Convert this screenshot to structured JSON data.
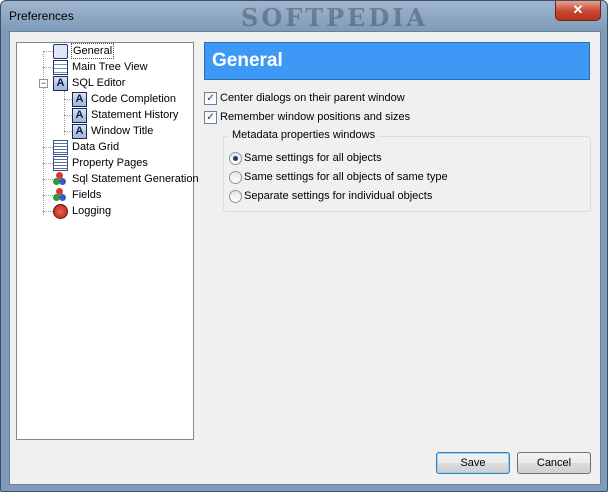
{
  "window": {
    "title": "Preferences",
    "watermark": "SOFTPEDIA",
    "close_glyph": "✕"
  },
  "tree": {
    "items": [
      {
        "label": "General",
        "icon": "general-page-icon"
      },
      {
        "label": "Main Tree View",
        "icon": "tree-view-icon"
      },
      {
        "label": "SQL Editor",
        "icon": "font-a-icon",
        "expanded": true
      },
      {
        "label": "Code Completion",
        "icon": "font-a-icon"
      },
      {
        "label": "Statement History",
        "icon": "font-a-icon"
      },
      {
        "label": "Window Title",
        "icon": "font-a-icon"
      },
      {
        "label": "Data Grid",
        "icon": "grid-icon"
      },
      {
        "label": "Property Pages",
        "icon": "grid-icon"
      },
      {
        "label": "Sql Statement Generation",
        "icon": "colored-balls-icon"
      },
      {
        "label": "Fields",
        "icon": "colored-balls-icon"
      },
      {
        "label": "Logging",
        "icon": "log-icon"
      }
    ],
    "selected": "General",
    "expander_glyph": "−",
    "a_glyph": "A"
  },
  "main": {
    "header": "General",
    "checkboxes": [
      {
        "label": "Center dialogs on their parent window",
        "checked": true
      },
      {
        "label": "Remember window positions and sizes",
        "checked": true
      }
    ],
    "check_glyph": "✓",
    "group": {
      "title": "Metadata properties windows",
      "options": [
        {
          "label": "Same settings for all objects",
          "selected": true
        },
        {
          "label": "Same settings for all objects of same type",
          "selected": false
        },
        {
          "label": "Separate settings for individual objects",
          "selected": false
        }
      ]
    }
  },
  "buttons": {
    "save": "Save",
    "cancel": "Cancel"
  },
  "colors": {
    "header_bg": "#3d99f5",
    "title_bg": "#7f9bb9",
    "close_bg": "#c6452f"
  }
}
